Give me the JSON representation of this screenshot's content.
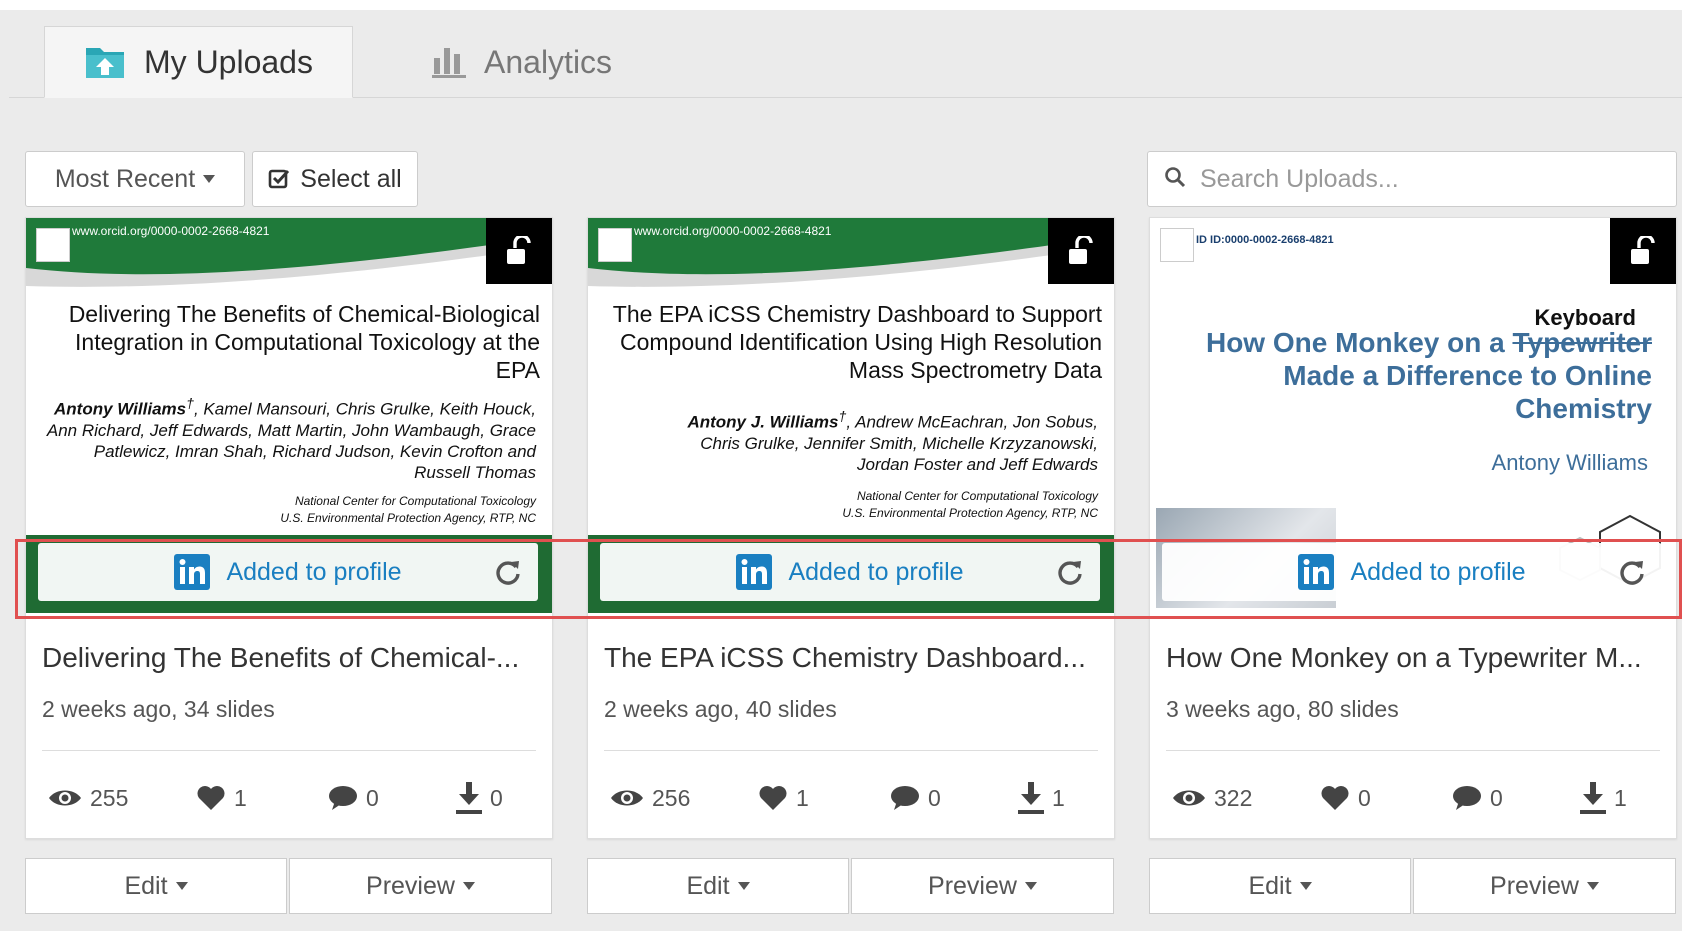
{
  "tabs": {
    "uploads": "My Uploads",
    "analytics": "Analytics"
  },
  "toolbar": {
    "sort_label": "Most Recent",
    "select_all_label": "Select all"
  },
  "search": {
    "placeholder": "Search Uploads..."
  },
  "cards": [
    {
      "thumb": {
        "url": "www.orcid.org/0000-0002-2668-4821",
        "title": "Delivering The Benefits of Chemical-Biological Integration in Computational Toxicology at the EPA",
        "lead_author": "Antony Williams",
        "lead_mark": "†",
        "authors_rest": ", Kamel Mansouri, Chris Grulke, Keith Houck, Ann Richard, Jeff Edwards, Matt Martin, John  Wambaugh, Grace Patlewicz, Imran Shah, Richard Judson, Kevin Crofton and Russell Thomas",
        "affil_1": "National Center for Computational Toxicology",
        "affil_2": "U.S. Environmental Protection Agency, RTP, NC"
      },
      "added": "Added to profile",
      "title": "Delivering The Benefits of Chemical-...",
      "meta": "2 weeks ago, 34 slides",
      "views": "255",
      "likes": "1",
      "comments": "0",
      "downloads": "0",
      "edit": "Edit",
      "preview": "Preview"
    },
    {
      "thumb": {
        "url": "www.orcid.org/0000-0002-2668-4821",
        "title": "The EPA iCSS Chemistry Dashboard to Support Compound Identification Using High Resolution Mass Spectrometry Data",
        "lead_author": "Antony J. Williams",
        "lead_mark": "†",
        "authors_rest": ", Andrew McEachran, Jon Sobus, Chris Grulke, Jennifer Smith, Michelle Krzyzanowski, Jordan Foster and Jeff Edwards",
        "affil_1": "National Center for Computational Toxicology",
        "affil_2": "U.S. Environmental Protection Agency, RTP, NC"
      },
      "added": "Added to profile",
      "title": "The EPA iCSS Chemistry Dashboard...",
      "meta": "2 weeks ago, 40 slides",
      "views": "256",
      "likes": "1",
      "comments": "0",
      "downloads": "1",
      "edit": "Edit",
      "preview": "Preview"
    },
    {
      "thumb": {
        "url": "ID ID:0000-0002-2668-4821",
        "keyword": "Keyboard",
        "title_a": "How One Monkey on a ",
        "title_strike": "Typewriter",
        "title_b": "Made a Difference to Online Chemistry",
        "author": "Antony Williams"
      },
      "added": "Added to profile",
      "title": "How One Monkey on a Typewriter M...",
      "meta": "3 weeks ago, 80 slides",
      "views": "322",
      "likes": "0",
      "comments": "0",
      "downloads": "1",
      "edit": "Edit",
      "preview": "Preview"
    }
  ],
  "colors": {
    "accent_link": "#1a7fc1",
    "slide_green": "#1f6b33",
    "highlight_red": "#e05050",
    "tab_icon_teal": "#2aa6b5"
  }
}
